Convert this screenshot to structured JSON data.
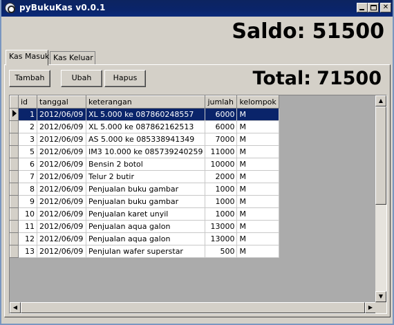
{
  "window": {
    "title": "pyBukuKas v0.0.1"
  },
  "saldo": {
    "label": "Saldo:",
    "value": "51500"
  },
  "tabs": [
    {
      "label": "Kas Masuk",
      "active": true
    },
    {
      "label": "Kas Keluar",
      "active": false
    }
  ],
  "toolbar": {
    "add_label": "Tambah",
    "edit_label": "Ubah",
    "delete_label": "Hapus"
  },
  "total": {
    "label": "Total:",
    "value": "71500"
  },
  "table": {
    "columns": [
      "id",
      "tanggal",
      "keterangan",
      "jumlah",
      "kelompok"
    ],
    "selected_row": 0,
    "rows": [
      [
        "1",
        "2012/06/09",
        "XL 5.000 ke 087860248557",
        "6000",
        "M"
      ],
      [
        "2",
        "2012/06/09",
        "XL 5.000 ke 087862162513",
        "6000",
        "M"
      ],
      [
        "3",
        "2012/06/09",
        "AS 5.000 ke 085338941349",
        "7000",
        "M"
      ],
      [
        "5",
        "2012/06/09",
        "IM3 10.000 ke 085739240259",
        "11000",
        "M"
      ],
      [
        "6",
        "2012/06/09",
        "Bensin 2 botol",
        "10000",
        "M"
      ],
      [
        "7",
        "2012/06/09",
        "Telur 2 butir",
        "2000",
        "M"
      ],
      [
        "8",
        "2012/06/09",
        "Penjualan buku gambar",
        "1000",
        "M"
      ],
      [
        "9",
        "2012/06/09",
        "Penjualan buku gambar",
        "1000",
        "M"
      ],
      [
        "10",
        "2012/06/09",
        "Penjualan karet unyil",
        "1000",
        "M"
      ],
      [
        "11",
        "2012/06/09",
        "Penjualan aqua galon",
        "13000",
        "M"
      ],
      [
        "12",
        "2012/06/09",
        "Penjualan aqua galon",
        "13000",
        "M"
      ],
      [
        "13",
        "2012/06/09",
        "Penjulan wafer superstar",
        "500",
        "M"
      ]
    ]
  }
}
